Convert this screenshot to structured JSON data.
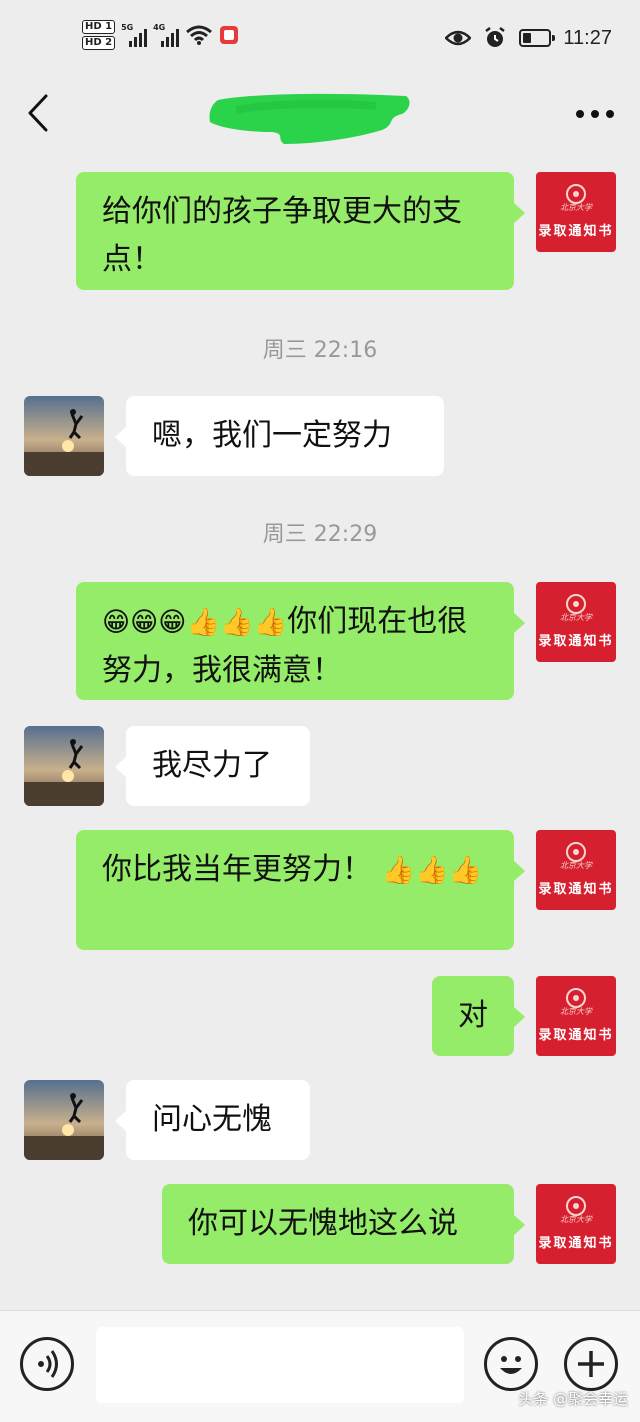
{
  "status_bar": {
    "hd1": "HD 1",
    "hd2": "HD 2",
    "net1": "5G",
    "net2": "4G",
    "time": "11:27",
    "battery_level_percent": 30,
    "icons": [
      "hd-icon",
      "signal-icon",
      "wifi-icon",
      "notification-badge-icon",
      "eye-icon",
      "alarm-icon",
      "battery-icon"
    ]
  },
  "nav": {
    "title": "",
    "back_icon": "chevron-left-icon",
    "more_icon": "more-dots-icon"
  },
  "chat": {
    "messages": [
      {
        "side": "right",
        "text": "给你们的孩子争取更大的支点！"
      },
      {
        "type": "time",
        "text": "周三 22:16"
      },
      {
        "side": "left",
        "text": "嗯，我们一定努力"
      },
      {
        "type": "time",
        "text": "周三 22:29"
      },
      {
        "side": "right",
        "text_emoji": "😁😁😁👍👍👍",
        "text": "你们现在也很努力，我很满意！"
      },
      {
        "side": "left",
        "text": "我尽力了"
      },
      {
        "side": "right",
        "text": "你比我当年更努力！",
        "text_emoji": "👍👍👍"
      },
      {
        "side": "right",
        "text": "对"
      },
      {
        "side": "left",
        "text": "问心无愧"
      },
      {
        "side": "right",
        "text": "你可以无愧地这么说"
      }
    ],
    "self_avatar": {
      "title": "录取通知书",
      "sub": "北京大学"
    }
  },
  "input_bar": {
    "placeholder": "",
    "voice_icon": "voice-icon",
    "emoji_icon": "emoji-smile-icon",
    "plus_icon": "plus-icon"
  },
  "watermark": "头条 @聚会幸运",
  "colors": {
    "bg": "#ededed",
    "bubble_self": "#95ec69",
    "bubble_other": "#ffffff",
    "letter_red": "#d7202f"
  }
}
